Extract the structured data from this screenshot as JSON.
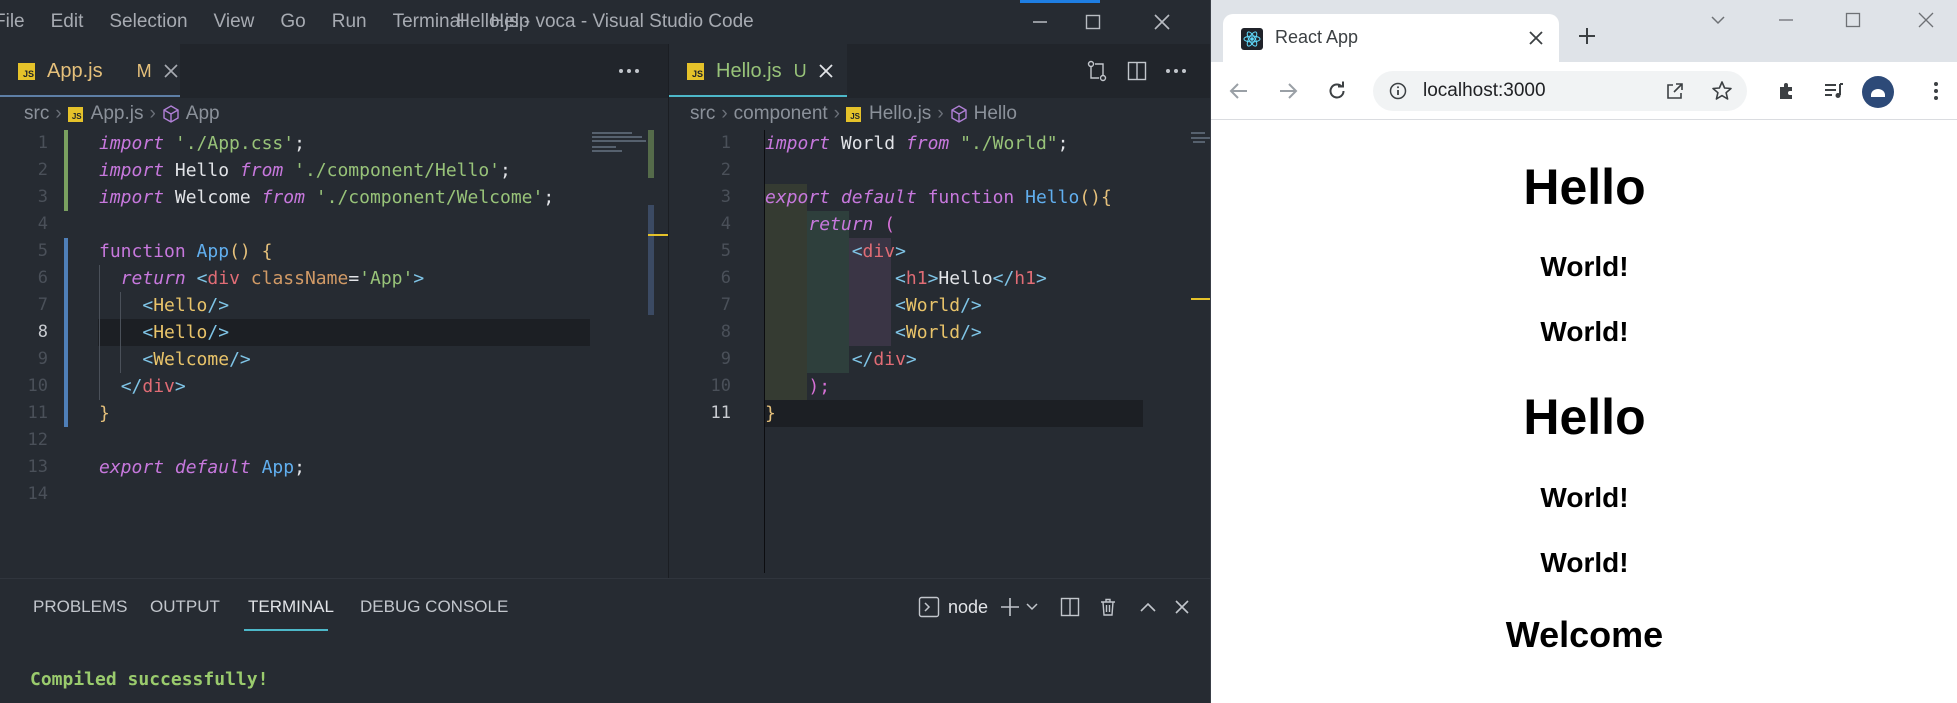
{
  "vscode": {
    "menu": [
      "File",
      "Edit",
      "Selection",
      "View",
      "Go",
      "Run",
      "Terminal",
      "Help"
    ],
    "window_title": "Hello.js - voca - Visual Studio Code",
    "left_tab": {
      "name": "App.js",
      "status": "M",
      "badge": "JS"
    },
    "right_tab": {
      "name": "Hello.js",
      "status": "U",
      "badge": "JS"
    },
    "more_icon": "ellipsis-icon",
    "left_breadcrumb": {
      "folder": "src",
      "file": "App.js",
      "symbol": "App"
    },
    "right_breadcrumb": {
      "folder": "src",
      "sub": "component",
      "file": "Hello.js",
      "symbol": "Hello"
    },
    "app_js": {
      "line_numbers": [
        "1",
        "2",
        "3",
        "4",
        "5",
        "6",
        "7",
        "8",
        "9",
        "10",
        "11",
        "12",
        "13",
        "14"
      ],
      "current_line": "8"
    },
    "hello_js": {
      "line_numbers": [
        "1",
        "2",
        "3",
        "4",
        "5",
        "6",
        "7",
        "8",
        "9",
        "10",
        "11"
      ],
      "current_line": "11"
    },
    "panel": {
      "tabs": [
        "PROBLEMS",
        "OUTPUT",
        "TERMINAL",
        "DEBUG CONSOLE"
      ],
      "active_tab": "TERMINAL",
      "terminal_name": "node",
      "output": "Compiled successfully!"
    },
    "colors": {
      "accent": "#61afef",
      "status_modified": "#e5c07b",
      "status_untracked": "#98c379",
      "tab_active_border": "#4db8c9"
    }
  },
  "chrome": {
    "tab_title": "React App",
    "url": "localhost:3000",
    "page": [
      {
        "level": "h1",
        "text": "Hello"
      },
      {
        "level": "h2",
        "text": "World!"
      },
      {
        "level": "h2",
        "text": "World!"
      },
      {
        "level": "h1",
        "text": "Hello"
      },
      {
        "level": "h2",
        "text": "World!"
      },
      {
        "level": "h2",
        "text": "World!"
      },
      {
        "level": "h1",
        "text": "Welcome"
      }
    ]
  }
}
